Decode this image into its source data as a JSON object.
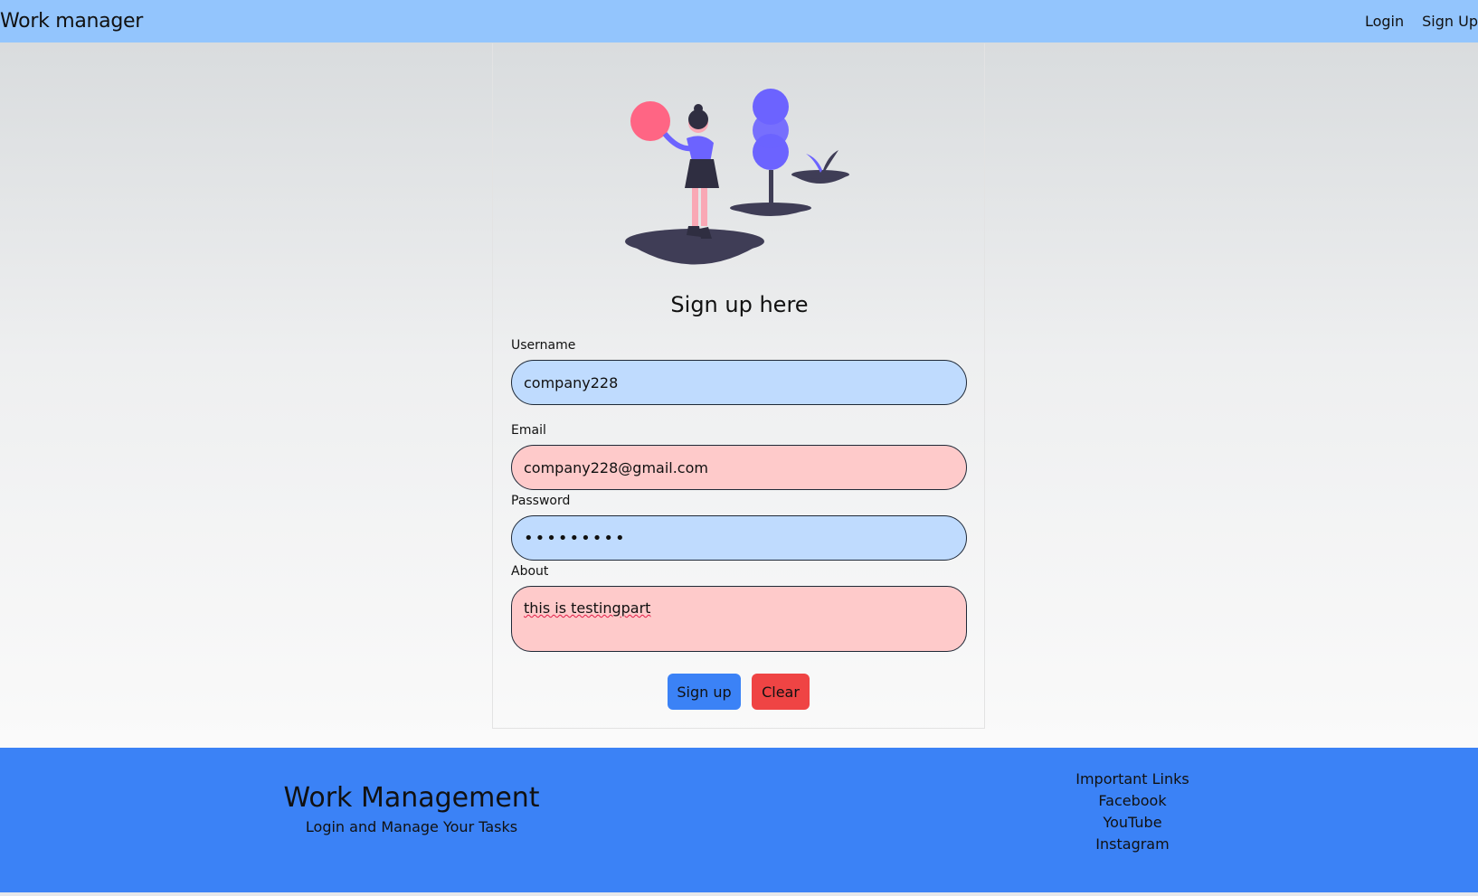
{
  "navbar": {
    "brand": "Work manager",
    "links": [
      {
        "label": "Login"
      },
      {
        "label": "Sign Up"
      }
    ]
  },
  "form": {
    "title": "Sign up here",
    "username": {
      "label": "Username",
      "value": "company228"
    },
    "email": {
      "label": "Email",
      "value": "company228@gmail.com"
    },
    "password": {
      "label": "Password",
      "value": "•••••••••"
    },
    "about": {
      "label": "About",
      "value": "this is testingpart"
    },
    "submit_label": "Sign up",
    "clear_label": "Clear"
  },
  "footer": {
    "title": "Work Management",
    "subtitle": "Login and Manage Your Tasks",
    "links_heading": "Important Links",
    "links": [
      "Facebook",
      "YouTube",
      "Instagram"
    ]
  },
  "colors": {
    "navbar": "#93c5fd",
    "footer": "#3b82f6",
    "field_blue": "#bfdbfe",
    "field_pink": "#fecaca",
    "primary_button": "#3b82f6",
    "danger_button": "#ef4444",
    "illustration_accent": "#6c63ff",
    "balloon": "#ff6584"
  }
}
